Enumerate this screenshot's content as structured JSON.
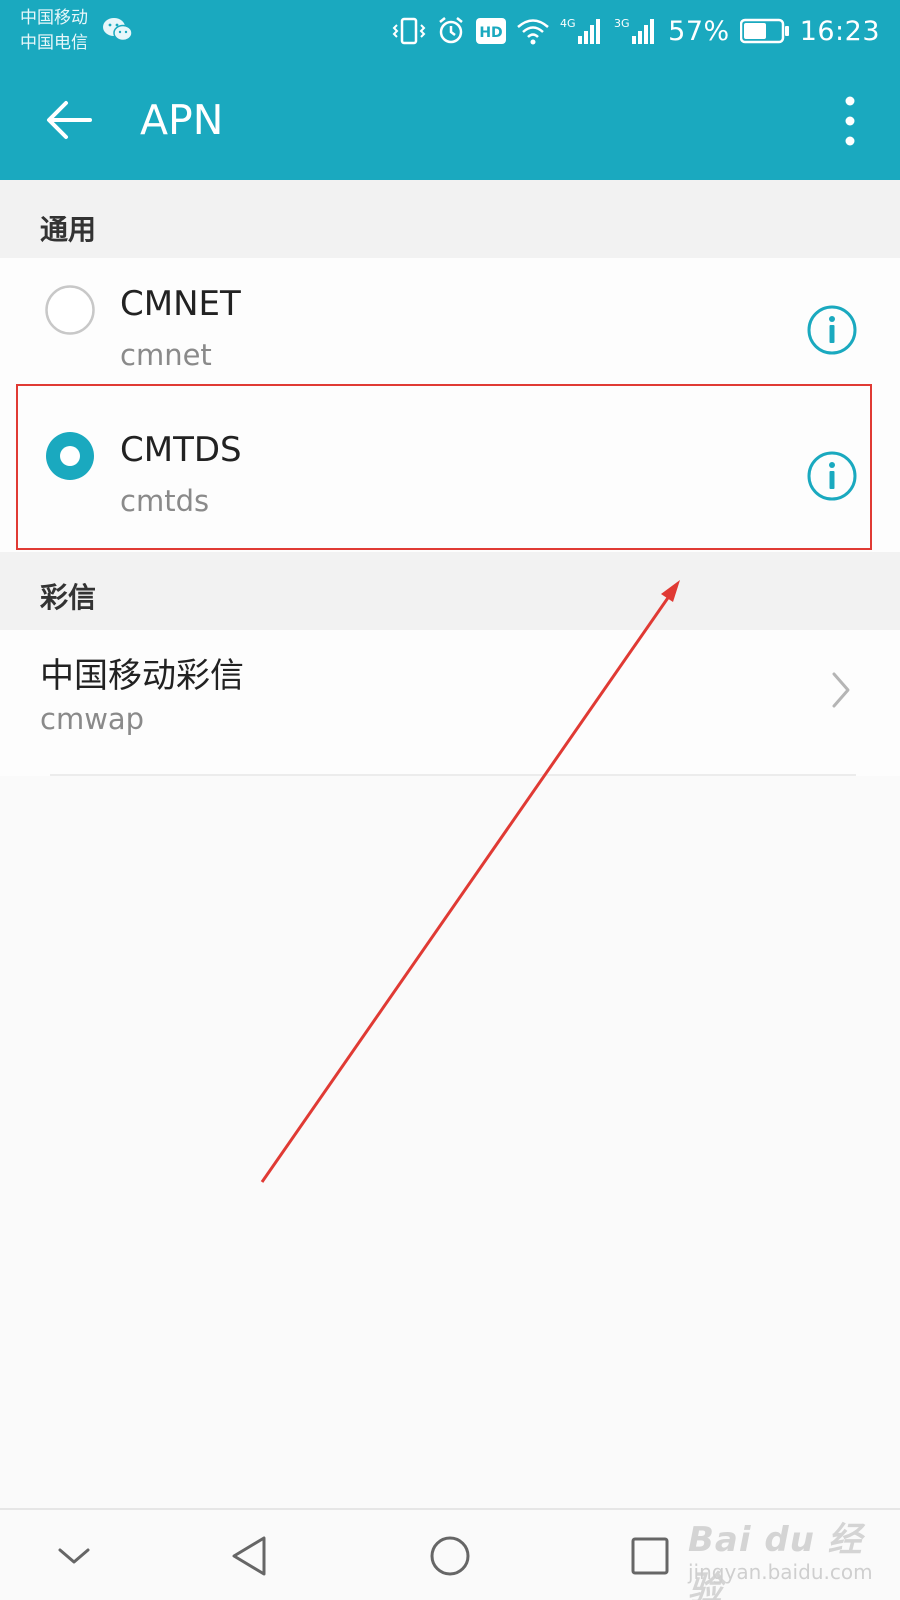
{
  "status_bar": {
    "carrier_1": "中国移动",
    "carrier_2": "中国电信",
    "net_1": "4G",
    "net_2": "3G",
    "hd_badge": "HD",
    "battery": "57%",
    "time": "16:23",
    "icons": [
      "wechat-icon",
      "vibrate-icon",
      "alarm-icon",
      "hd-icon",
      "wifi-icon",
      "signal-icon",
      "signal-icon",
      "battery-icon"
    ]
  },
  "app_bar": {
    "title": "APN",
    "icons": [
      "back-arrow-icon",
      "overflow-menu-icon"
    ]
  },
  "sections": {
    "general": {
      "header": "通用",
      "items": [
        {
          "name": "CMNET",
          "apn": "cmnet",
          "selected": false
        },
        {
          "name": "CMTDS",
          "apn": "cmtds",
          "selected": true
        }
      ]
    },
    "mms": {
      "header": "彩信",
      "items": [
        {
          "name": "中国移动彩信",
          "apn": "cmwap"
        }
      ]
    }
  },
  "nav_bar": {
    "icons": [
      "nav-collapse-icon",
      "nav-back-icon",
      "nav-home-icon",
      "nav-recent-icon"
    ]
  },
  "watermark": {
    "brand": "Bai du 经验",
    "url": "jingyan.baidu.com"
  },
  "colors": {
    "accent": "#1aa9bf",
    "annotation": "#e03a34"
  }
}
